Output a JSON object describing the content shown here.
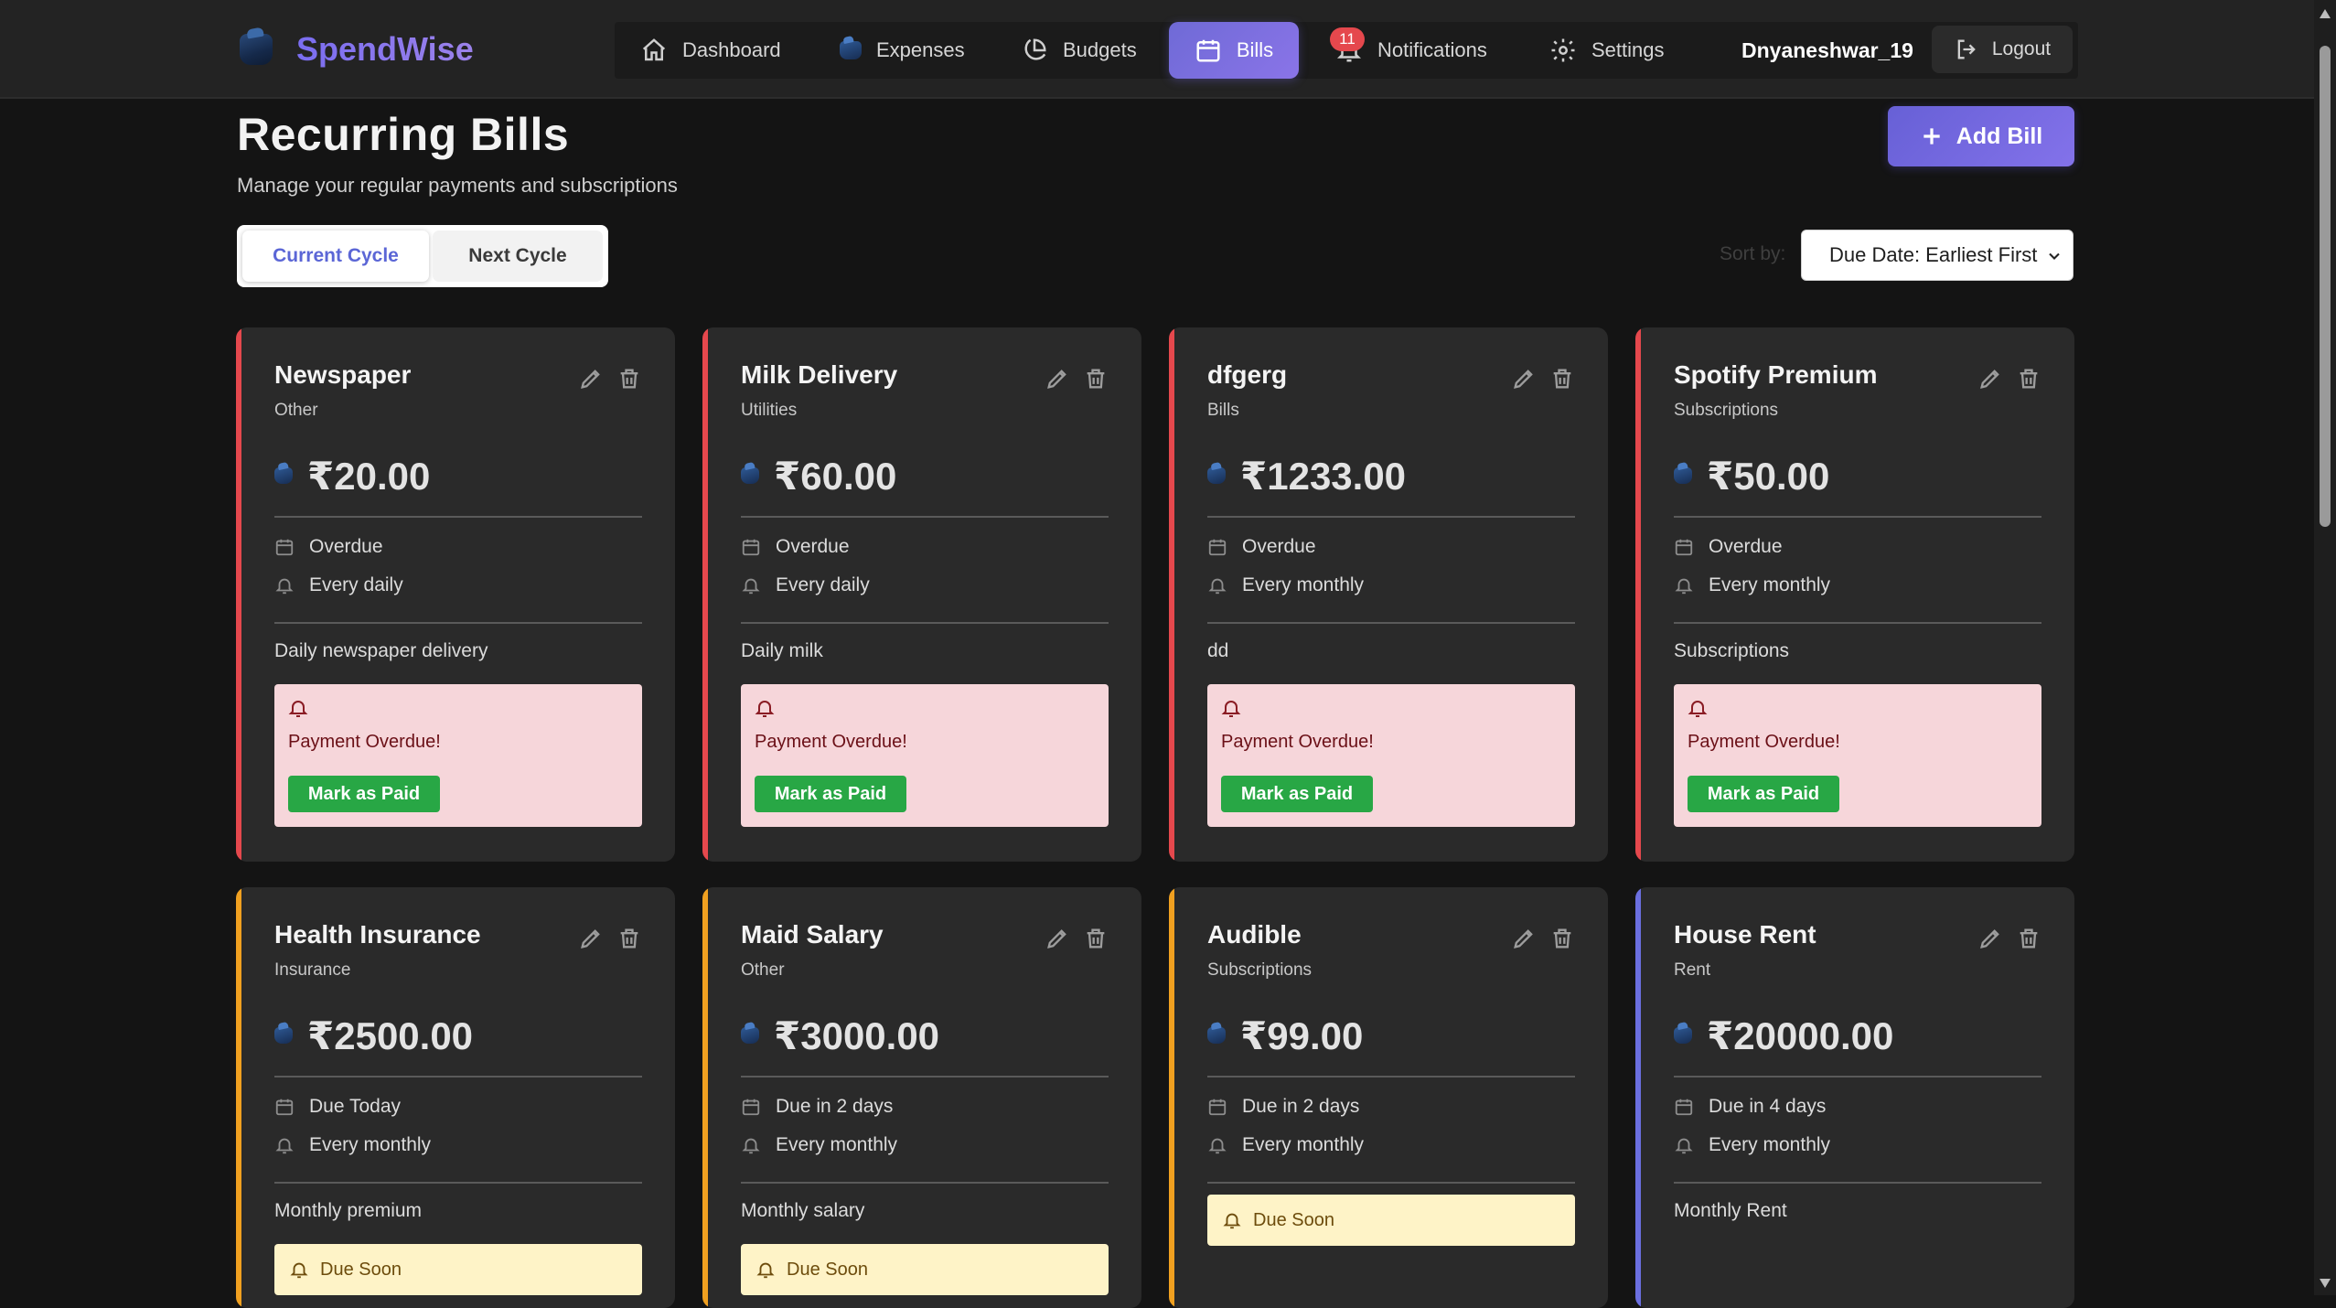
{
  "app": {
    "name": "SpendWise"
  },
  "nav": {
    "dashboard": "Dashboard",
    "expenses": "Expenses",
    "budgets": "Budgets",
    "bills": "Bills",
    "notifications": "Notifications",
    "notifications_count": "11",
    "settings": "Settings",
    "username": "Dnyaneshwar_19",
    "logout": "Logout",
    "active_tab": "Bills"
  },
  "page": {
    "title": "Recurring Bills",
    "subtitle": "Manage your regular payments and subscriptions",
    "add_bill": "Add Bill",
    "cycle": {
      "current": "Current Cycle",
      "next": "Next Cycle",
      "selected": "Current Cycle"
    },
    "sort_label": "Sort by:",
    "sort_value": "Due Date: Earliest First"
  },
  "colors": {
    "accent": "#7a6df0",
    "overdue": "#e5484d",
    "due_soon": "#f0a020",
    "upcoming": "#6b6fe0",
    "paid_button": "#28a745"
  },
  "bills": [
    {
      "title": "Newspaper",
      "category": "Other",
      "amount": "₹20.00",
      "due": "Overdue",
      "frequency": "Every daily",
      "description": "Daily newspaper delivery",
      "status": "overdue",
      "alert": "Payment Overdue!",
      "action": "Mark as Paid"
    },
    {
      "title": "Milk Delivery",
      "category": "Utilities",
      "amount": "₹60.00",
      "due": "Overdue",
      "frequency": "Every daily",
      "description": "Daily milk",
      "status": "overdue",
      "alert": "Payment Overdue!",
      "action": "Mark as Paid"
    },
    {
      "title": "dfgerg",
      "category": "Bills",
      "amount": "₹1233.00",
      "due": "Overdue",
      "frequency": "Every monthly",
      "description": "dd",
      "status": "overdue",
      "alert": "Payment Overdue!",
      "action": "Mark as Paid"
    },
    {
      "title": "Spotify Premium",
      "category": "Subscriptions",
      "amount": "₹50.00",
      "due": "Overdue",
      "frequency": "Every monthly",
      "description": "Subscriptions",
      "status": "overdue",
      "alert": "Payment Overdue!",
      "action": "Mark as Paid"
    },
    {
      "title": "Health Insurance",
      "category": "Insurance",
      "amount": "₹2500.00",
      "due": "Due Today",
      "frequency": "Every monthly",
      "description": "Monthly premium",
      "status": "soon",
      "alert": "Due Soon"
    },
    {
      "title": "Maid Salary",
      "category": "Other",
      "amount": "₹3000.00",
      "due": "Due in 2 days",
      "frequency": "Every monthly",
      "description": "Monthly salary",
      "status": "soon",
      "alert": "Due Soon"
    },
    {
      "title": "Audible",
      "category": "Subscriptions",
      "amount": "₹99.00",
      "due": "Due in 2 days",
      "frequency": "Every monthly",
      "description": "",
      "status": "soon",
      "alert": "Due Soon"
    },
    {
      "title": "House Rent",
      "category": "Rent",
      "amount": "₹20000.00",
      "due": "Due in 4 days",
      "frequency": "Every monthly",
      "description": "Monthly Rent",
      "status": "upcoming",
      "alert": ""
    }
  ]
}
